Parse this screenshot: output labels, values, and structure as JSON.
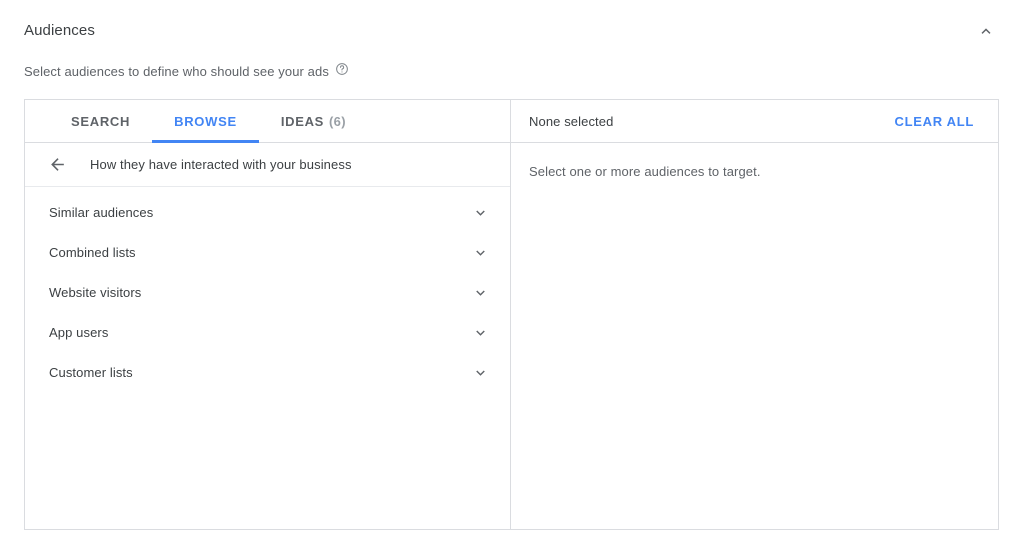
{
  "section": {
    "title": "Audiences",
    "subtitle": "Select audiences to define who should see your ads",
    "help_icon": "help-circle-icon",
    "collapse_icon": "chevron-up-icon"
  },
  "tabs": [
    {
      "label": "SEARCH",
      "count": null,
      "active": false
    },
    {
      "label": "BROWSE",
      "count": null,
      "active": true
    },
    {
      "label": "IDEAS",
      "count": "(6)",
      "active": false
    }
  ],
  "breadcrumb": {
    "back_icon": "arrow-left-icon",
    "label": "How they have interacted with your business"
  },
  "categories": [
    {
      "label": "Similar audiences",
      "expand_icon": "chevron-down-icon"
    },
    {
      "label": "Combined lists",
      "expand_icon": "chevron-down-icon"
    },
    {
      "label": "Website visitors",
      "expand_icon": "chevron-down-icon"
    },
    {
      "label": "App users",
      "expand_icon": "chevron-down-icon"
    },
    {
      "label": "Customer lists",
      "expand_icon": "chevron-down-icon"
    }
  ],
  "selection": {
    "status": "None selected",
    "clear_all_label": "CLEAR ALL",
    "empty_message": "Select one or more audiences to target."
  },
  "colors": {
    "accent_blue": "#4285f4",
    "text_primary": "#3c4043",
    "text_secondary": "#5f6368",
    "text_muted": "#9aa0a6",
    "border": "#dadce0"
  }
}
